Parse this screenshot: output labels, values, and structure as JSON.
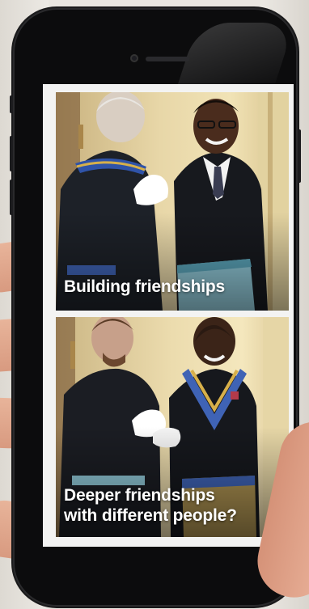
{
  "slides": [
    {
      "caption": "Building friendships"
    },
    {
      "caption_line1": "Deeper friendships",
      "caption_line2": "with different people?"
    }
  ],
  "colors": {
    "phone_body": "#0c0c0d",
    "screen_bg": "#f3f3f2",
    "caption_text": "#ffffff",
    "sash_blue": "#3f63b5",
    "sash_gold": "#d7b04a",
    "apron_light_blue": "#8fc7d6"
  }
}
